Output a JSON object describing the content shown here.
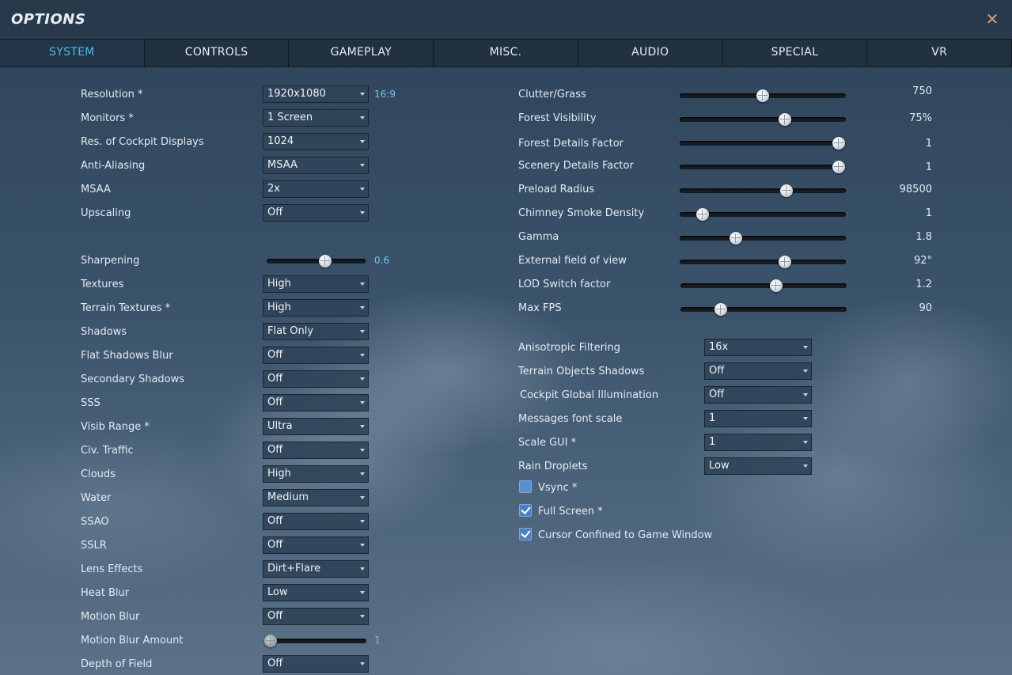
{
  "window": {
    "title": "OPTIONS",
    "close_icon": "close-icon"
  },
  "tabs": [
    "SYSTEM",
    "CONTROLS",
    "GAMEPLAY",
    "MISC.",
    "AUDIO",
    "SPECIAL",
    "VR"
  ],
  "active_tab": "SYSTEM",
  "colors": {
    "accent": "#4fb7e6",
    "close": "#d7a27c",
    "checkbox": "#4c7fc4"
  },
  "left": {
    "resolution": {
      "label": "Resolution *",
      "value": "1920x1080",
      "note": "16:9"
    },
    "monitors": {
      "label": "Monitors *",
      "value": "1 Screen"
    },
    "cockpit_displays": {
      "label": "Res. of Cockpit Displays",
      "value": "1024"
    },
    "anti_aliasing": {
      "label": "Anti-Aliasing",
      "value": "MSAA"
    },
    "msaa": {
      "label": "MSAA",
      "value": "2x"
    },
    "upscaling": {
      "label": "Upscaling",
      "value": "Off"
    },
    "sharpening": {
      "label": "Sharpening",
      "value": "0.6",
      "level": 0.6
    },
    "textures": {
      "label": "Textures",
      "value": "High"
    },
    "terrain_textures": {
      "label": "Terrain Textures *",
      "value": "High"
    },
    "shadows": {
      "label": "Shadows",
      "value": "Flat Only"
    },
    "flat_shadows_blur": {
      "label": "Flat Shadows Blur",
      "value": "Off"
    },
    "secondary_shadows": {
      "label": "Secondary Shadows",
      "value": "Off"
    },
    "sss": {
      "label": "SSS",
      "value": "Off"
    },
    "visib_range": {
      "label": "Visib Range *",
      "value": "Ultra"
    },
    "civ_traffic": {
      "label": "Civ. Traffic",
      "value": "Off"
    },
    "clouds": {
      "label": "Clouds",
      "value": "High"
    },
    "water": {
      "label": "Water",
      "value": "Medium"
    },
    "ssao": {
      "label": "SSAO",
      "value": "Off"
    },
    "sslr": {
      "label": "SSLR",
      "value": "Off"
    },
    "lens_effects": {
      "label": "Lens Effects",
      "value": "Dirt+Flare"
    },
    "heat_blur": {
      "label": "Heat Blur",
      "value": "Low"
    },
    "motion_blur": {
      "label": "Motion Blur",
      "value": "Off"
    },
    "motion_blur_amount": {
      "label": "Motion Blur Amount",
      "value": "1",
      "level": 0.0
    },
    "depth_of_field": {
      "label": "Depth of Field",
      "value": "Off"
    }
  },
  "right": {
    "clutter": {
      "label": "Clutter/Grass",
      "value": "750",
      "level": 0.5
    },
    "forest_visibility": {
      "label": "Forest Visibility",
      "value": "75%",
      "level": 0.64
    },
    "forest_details": {
      "label": "Forest Details Factor",
      "value": "1",
      "level": 1.0
    },
    "scenery_details": {
      "label": "Scenery Details Factor",
      "value": "1",
      "level": 1.0
    },
    "preload_radius": {
      "label": "Preload Radius",
      "value": "98500",
      "level": 0.65
    },
    "chimney_smoke": {
      "label": "Chimney Smoke Density",
      "value": "1",
      "level": 0.12
    },
    "gamma": {
      "label": "Gamma",
      "value": "1.8",
      "level": 0.33
    },
    "external_fov": {
      "label": "External field of view",
      "value": "92°",
      "level": 0.64
    },
    "lod_switch": {
      "label": "LOD Switch factor",
      "value": "1.2",
      "level": 0.58
    },
    "max_fps": {
      "label": "Max FPS",
      "value": "90",
      "level": 0.23
    },
    "anisotropic": {
      "label": "Anisotropic Filtering",
      "value": "16x"
    },
    "terrain_obj_shadows": {
      "label": "Terrain Objects Shadows",
      "value": "Off"
    },
    "cockpit_gi": {
      "label": "Cockpit Global Illumination",
      "value": "Off"
    },
    "messages_font": {
      "label": "Messages font scale",
      "value": "1"
    },
    "scale_gui": {
      "label": "Scale GUI *",
      "value": "1"
    },
    "rain_droplets": {
      "label": "Rain Droplets",
      "value": "Low"
    },
    "vsync": {
      "label": "Vsync *",
      "checked": false
    },
    "full_screen": {
      "label": "Full Screen *",
      "checked": true
    },
    "cursor_confined": {
      "label": "Cursor Confined to Game Window",
      "checked": true
    }
  }
}
